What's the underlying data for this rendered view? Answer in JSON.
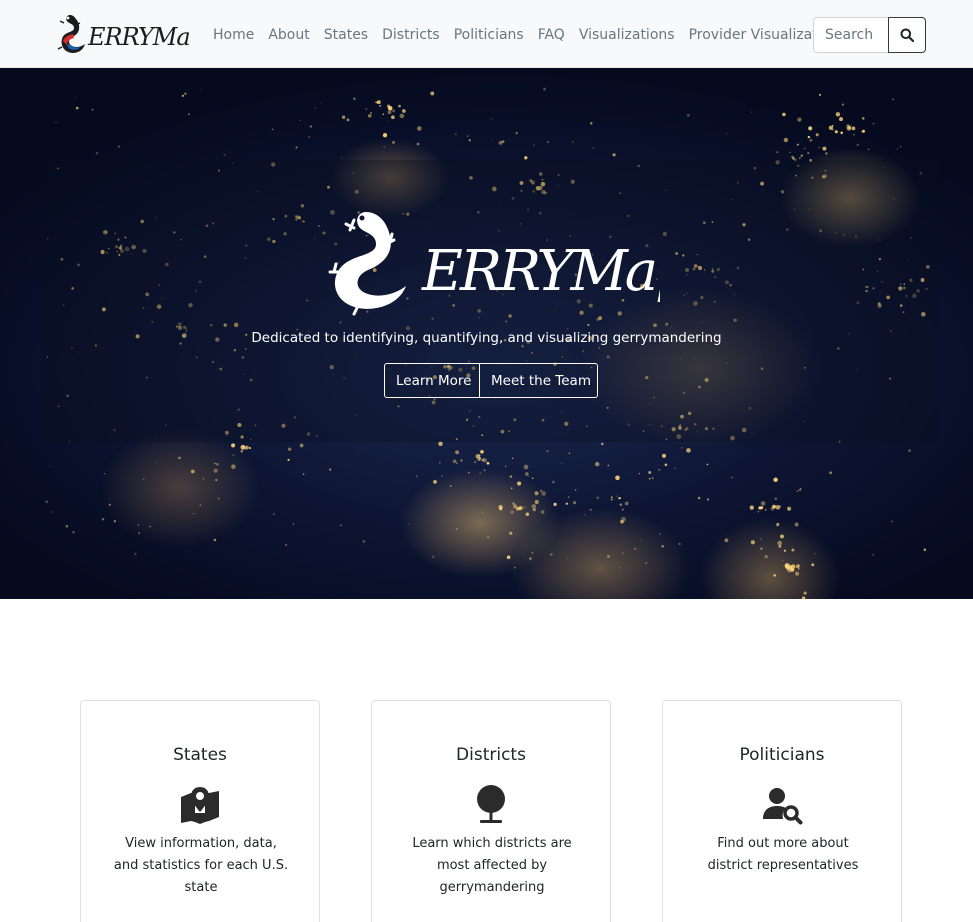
{
  "navbar": {
    "brand_name": "GerryMap",
    "links": [
      "Home",
      "About",
      "States",
      "Districts",
      "Politicians",
      "FAQ",
      "Visualizations",
      "Provider Visualizations"
    ],
    "search_placeholder": "Search"
  },
  "hero": {
    "logo_text": "GerryMap",
    "tagline": "Dedicated to identifying, quantifying, and visualizing gerrymandering",
    "buttons": [
      "Learn More",
      "Meet the Team"
    ]
  },
  "cards": [
    {
      "title": "States",
      "icon": "map-pin-icon",
      "text": "View information, data, and statistics for each U.S. state"
    },
    {
      "title": "Districts",
      "icon": "globe-stand-icon",
      "text": "Learn which districts are most affected by gerrymandering"
    },
    {
      "title": "Politicians",
      "icon": "user-search-icon",
      "text": "Find out more about district representatives"
    }
  ],
  "colors": {
    "navbar_bg": "#f8f9fa",
    "nav_link": "#6c757d",
    "hero_bg": "#0d1533",
    "city_light": "#ffd57a",
    "card_border": "#dfe1e3"
  }
}
